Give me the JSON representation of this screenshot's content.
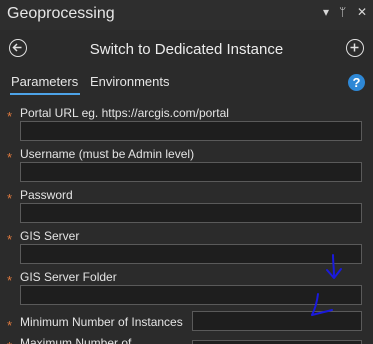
{
  "pane": {
    "title": "Geoprocessing",
    "controls": {
      "dropdown": "▾",
      "pin": "ᛘ",
      "close": "✕"
    }
  },
  "tool": {
    "title": "Switch to Dedicated Instance",
    "back_icon": "back-arrow-icon",
    "add_icon": "add-icon"
  },
  "tabs": {
    "parameters": "Parameters",
    "environments": "Environments",
    "help": "?"
  },
  "parameters": [
    {
      "label": "Portal URL eg. https://arcgis.com/portal",
      "required": true,
      "value": ""
    },
    {
      "label": "Username (must be Admin level)",
      "required": true,
      "value": ""
    },
    {
      "label": "Password",
      "required": true,
      "value": ""
    },
    {
      "label": "GIS Server",
      "required": true,
      "value": ""
    },
    {
      "label": "GIS Server Folder",
      "required": true,
      "value": ""
    },
    {
      "label": "Minimum Number of Instances",
      "required": true,
      "value": ""
    },
    {
      "label": "Maximum Number of",
      "required": true,
      "value": ""
    }
  ],
  "required_marker": "*",
  "colors": {
    "background": "#2b2b2b",
    "field": "#1e1e1e",
    "required": "#e07a3e",
    "accent": "#4da3e8",
    "annotation": "#1a1adc"
  },
  "annotations": [
    "hand-drawn-arrow-down",
    "hand-drawn-arrow-down-left"
  ]
}
